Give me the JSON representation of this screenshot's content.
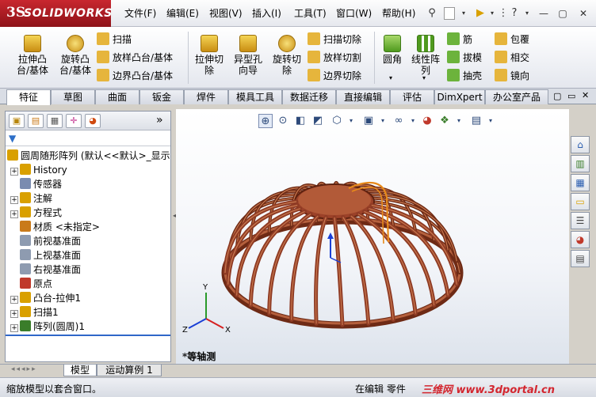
{
  "app": {
    "logo_ds": "3S",
    "logo_text": "SOLIDWORKS"
  },
  "menu": [
    "文件(F)",
    "编辑(E)",
    "视图(V)",
    "插入(I)",
    "工具(T)",
    "窗口(W)",
    "帮助(H)"
  ],
  "ribbon": {
    "extrude_boss": "拉伸凸台/基体",
    "revolve_boss": "旋转凸台/基体",
    "sweep": "扫描",
    "loft_boss": "放样凸台/基体",
    "boundary_boss": "边界凸台/基体",
    "extrude_cut": "拉伸切除",
    "hole_wizard": "异型孔向导",
    "revolve_cut": "旋转切除",
    "sweep_cut": "扫描切除",
    "loft_cut": "放样切割",
    "boundary_cut": "边界切除",
    "fillet": "圆角",
    "linear_pattern": "线性阵列",
    "rib": "筋",
    "draft": "拔模",
    "shell": "抽壳",
    "wrap": "包覆",
    "intersect": "相交",
    "mirror": "镜向"
  },
  "tabs": [
    "特征",
    "草图",
    "曲面",
    "钣金",
    "焊件",
    "模具工具",
    "数据迁移",
    "直接编辑",
    "评估",
    "DimXpert",
    "办公室产品"
  ],
  "tree": {
    "root": "圆周随形阵列 (默认<<默认>_显示",
    "items": [
      {
        "label": "History",
        "icon": "history-icon",
        "expand": "+"
      },
      {
        "label": "传感器",
        "icon": "sensor-icon",
        "expand": ""
      },
      {
        "label": "注解",
        "icon": "annotation-icon",
        "expand": "+"
      },
      {
        "label": "方程式",
        "icon": "equation-icon",
        "expand": "+"
      },
      {
        "label": "材质 <未指定>",
        "icon": "material-icon",
        "expand": ""
      },
      {
        "label": "前视基准面",
        "icon": "plane-icon",
        "expand": ""
      },
      {
        "label": "上视基准面",
        "icon": "plane-icon",
        "expand": ""
      },
      {
        "label": "右视基准面",
        "icon": "plane-icon",
        "expand": ""
      },
      {
        "label": "原点",
        "icon": "origin-icon",
        "expand": ""
      },
      {
        "label": "凸台-拉伸1",
        "icon": "extrude-icon",
        "expand": "+"
      },
      {
        "label": "扫描1",
        "icon": "sweep-icon",
        "expand": "+"
      },
      {
        "label": "阵列(圆周)1",
        "icon": "circular-pattern-icon",
        "expand": "+"
      }
    ]
  },
  "panel_more": "»",
  "viewport": {
    "view_label": "*等轴测",
    "axis_x": "X",
    "axis_y": "Y",
    "axis_z": "Z"
  },
  "bottom_tabs": [
    "模型",
    "运动算例 1"
  ],
  "status": {
    "message": "缩放模型以套合窗口。",
    "mode": "在编辑 零件",
    "watermark": "三维网 www.3dportal.cn"
  },
  "colors": {
    "wood": "#8f3b24",
    "wood_light": "#b5603d",
    "accent_orange": "#e88a1a",
    "sw_red": "#b81d25"
  }
}
